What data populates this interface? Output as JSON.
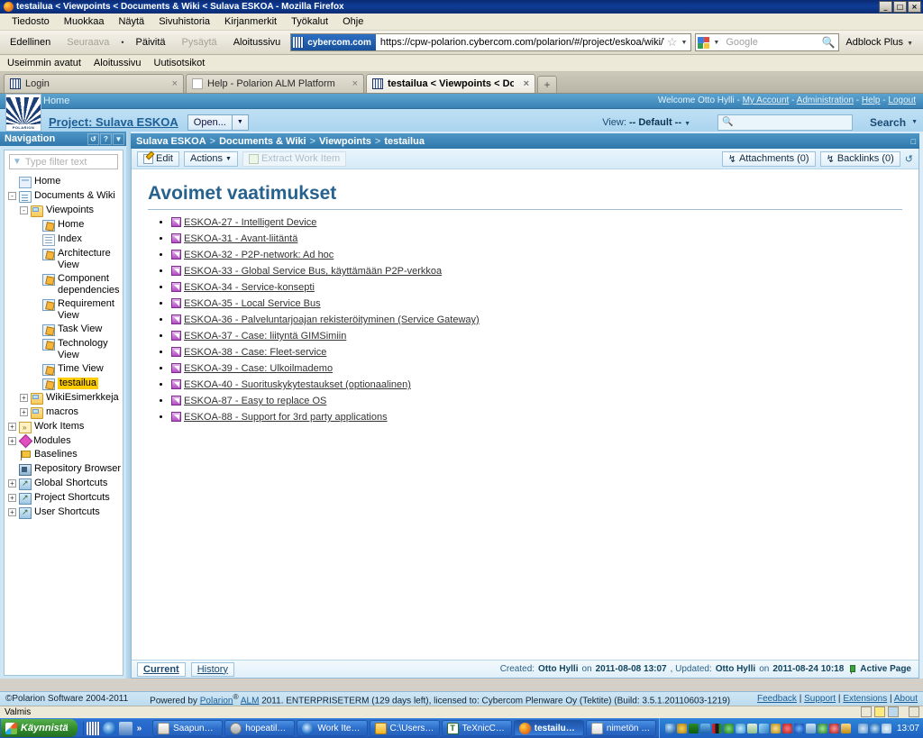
{
  "window": {
    "title": "testailua < Viewpoints < Documents & Wiki < Sulava ESKOA - Mozilla Firefox",
    "minimize": "_",
    "maximize": "□",
    "close": "×"
  },
  "menubar": [
    {
      "label": "Tiedosto"
    },
    {
      "label": "Muokkaa"
    },
    {
      "label": "Näytä"
    },
    {
      "label": "Sivuhistoria"
    },
    {
      "label": "Kirjanmerkit"
    },
    {
      "label": "Työkalut"
    },
    {
      "label": "Ohje"
    }
  ],
  "navbar": {
    "back": "Edellinen",
    "forward": "Seuraava",
    "dot": "•",
    "reload": "Päivitä",
    "stop": "Pysäytä",
    "home": "Aloitussivu",
    "site_identity": "cybercom.com",
    "url": "https://cpw-polarion.cybercom.com/polarion/#/project/eskoa/wiki/Viewpoints/testailua",
    "bookmark_star": "☆",
    "dropdown_caret": "▼",
    "search_engine": "google-icon",
    "search_placeholder": "Google",
    "search_magnifier": "🔍",
    "adblock": "Adblock Plus"
  },
  "bookmarks_bar": [
    {
      "label": "Useimmin avatut"
    },
    {
      "label": "Aloitussivu"
    },
    {
      "label": "Uutisotsikot"
    }
  ],
  "tabs": [
    {
      "label": "Login",
      "close": "×",
      "active": false,
      "favicon": "polarion-favicon"
    },
    {
      "label": "Help - Polarion ALM Platform",
      "close": "×",
      "active": false,
      "favicon": "doc-favicon"
    },
    {
      "label": "testailua < Viewpoints < Docume...",
      "close": "×",
      "active": true,
      "favicon": "polarion-favicon"
    }
  ],
  "new_tab": "+",
  "polarion": {
    "home_crumb": "Home",
    "account": {
      "welcome": "Welcome Otto Hylli",
      "sep": "-",
      "my_account": "My Account",
      "administration": "Administration",
      "help": "Help",
      "logout": "Logout"
    },
    "logo_wordmark": "POLARION",
    "project_label": "Project: Sulava ESKOA",
    "open_button": "Open...",
    "open_caret": "▼",
    "view_label": "View:",
    "view_value": "-- Default --",
    "view_caret": "▼",
    "header_search_placeholder": "",
    "search_button": "Search",
    "search_caret": "▼"
  },
  "navigation": {
    "caption": "Navigation",
    "tool_refresh": "↺",
    "tool_help": "?",
    "tool_menu": "▼",
    "filter_placeholder": "Type filter text",
    "tree": [
      {
        "label": "Home",
        "depth": 0,
        "icon": "page-icon",
        "expander": "none"
      },
      {
        "label": "Documents & Wiki",
        "depth": 0,
        "icon": "doc-icon",
        "expander": "-"
      },
      {
        "label": "Viewpoints",
        "depth": 1,
        "icon": "wiki-folder-icon",
        "expander": "-"
      },
      {
        "label": "Home",
        "depth": 2,
        "icon": "wiki-page-icon",
        "expander": "none"
      },
      {
        "label": "Index",
        "depth": 2,
        "icon": "index-icon",
        "expander": "none"
      },
      {
        "label": "Architecture View",
        "depth": 2,
        "icon": "wiki-page-icon",
        "expander": "none"
      },
      {
        "label": "Component dependencies",
        "depth": 2,
        "icon": "wiki-page-icon",
        "expander": "none"
      },
      {
        "label": "Requirement View",
        "depth": 2,
        "icon": "wiki-page-icon",
        "expander": "none"
      },
      {
        "label": "Task View",
        "depth": 2,
        "icon": "wiki-page-icon",
        "expander": "none"
      },
      {
        "label": "Technology View",
        "depth": 2,
        "icon": "wiki-page-icon",
        "expander": "none"
      },
      {
        "label": "Time View",
        "depth": 2,
        "icon": "wiki-page-icon",
        "expander": "none"
      },
      {
        "label": "testailua",
        "depth": 2,
        "icon": "wiki-page-icon",
        "expander": "none",
        "selected": true
      },
      {
        "label": "WikiEsimerkkeja",
        "depth": 1,
        "icon": "wiki-folder-icon",
        "expander": "+"
      },
      {
        "label": "macros",
        "depth": 1,
        "icon": "wiki-folder-icon",
        "expander": "+"
      },
      {
        "label": "Work Items",
        "depth": 0,
        "icon": "work-item-icon",
        "expander": "+"
      },
      {
        "label": "Modules",
        "depth": 0,
        "icon": "module-icon",
        "expander": "+"
      },
      {
        "label": "Baselines",
        "depth": 0,
        "icon": "flag-icon",
        "expander": "none"
      },
      {
        "label": "Repository Browser",
        "depth": 0,
        "icon": "repository-icon",
        "expander": "none"
      },
      {
        "label": "Global Shortcuts",
        "depth": 0,
        "icon": "shortcut-icon",
        "expander": "+"
      },
      {
        "label": "Project Shortcuts",
        "depth": 0,
        "icon": "shortcut-icon",
        "expander": "+"
      },
      {
        "label": "User Shortcuts",
        "depth": 0,
        "icon": "shortcut-icon",
        "expander": "+"
      }
    ]
  },
  "breadcrumb": {
    "parts": [
      "Sulava ESKOA",
      "Documents & Wiki",
      "Viewpoints",
      "testailua"
    ],
    "separator": ">",
    "corner": "□"
  },
  "doc_toolbar": {
    "edit": "Edit",
    "actions": "Actions",
    "actions_caret": "▼",
    "extract": "Extract Work Item",
    "attachments": "Attachments (0)",
    "backlinks": "Backlinks (0)",
    "pin_glyph": "↯",
    "refresh": "↺"
  },
  "document": {
    "title": "Avoimet vaatimukset",
    "items": [
      {
        "label": "ESKOA-27 - Intelligent Device"
      },
      {
        "label": "ESKOA-31 - Avant-liitäntä"
      },
      {
        "label": "ESKOA-32 - P2P-network: Ad hoc"
      },
      {
        "label": "ESKOA-33 - Global Service Bus, käyttämään P2P-verkkoa"
      },
      {
        "label": "ESKOA-34 - Service-konsepti"
      },
      {
        "label": "ESKOA-35 - Local Service Bus"
      },
      {
        "label": "ESKOA-36 - Palveluntarjoajan rekisteröityminen (Service Gateway)"
      },
      {
        "label": "ESKOA-37 - Case: liityntä GIMSimiin"
      },
      {
        "label": "ESKOA-38 - Case: Fleet-service"
      },
      {
        "label": "ESKOA-39 - Case: Ulkoilmademo"
      },
      {
        "label": "ESKOA-40 - Suorituskykytestaukset (optionaalinen)"
      },
      {
        "label": "ESKOA-87 - Easy to replace OS"
      },
      {
        "label": "ESKOA-88 - Support for 3rd party applications"
      }
    ]
  },
  "doc_footer": {
    "tab_current": "Current",
    "tab_history": "History",
    "created_label": "Created:",
    "created_user": "Otto Hylli",
    "created_on": "on",
    "created_date": "2011-08-08 13:07",
    "updated_label": ", Updated:",
    "updated_user": "Otto Hylli",
    "updated_on": "on",
    "updated_date": "2011-08-24 10:18",
    "active_page": "Active Page"
  },
  "polarion_footer": {
    "copyright": "©Polarion Software 2004-2011",
    "powered_prefix": "Powered by",
    "powered_link": "Polarion",
    "powered_reg": "®",
    "powered_alm": "ALM",
    "powered_rest": "2011. ENTERPRISETERM (129 days left), licensed to: Cybercom Plenware Oy (Tektite) (Build: 3.5.1.20110603-1219)",
    "links": [
      "Feedback",
      "Support",
      "Extensions",
      "About"
    ],
    "link_sep": "|"
  },
  "ff_status": "Valmis",
  "taskbar": {
    "start": "Käynnistä",
    "quick_launch": [
      "polarion-quick-icon",
      "internet-explorer-icon",
      "show-desktop-icon"
    ],
    "chevron": "»",
    "tasks": [
      {
        "label": "Saapuneet ...",
        "icon": "mail-icon",
        "active": false
      },
      {
        "label": "hopeatilhi.c...",
        "icon": "gear-icon",
        "active": false
      },
      {
        "label": "Work Items...",
        "icon": "internet-explorer-icon",
        "active": false
      },
      {
        "label": "C:\\Users\\O...",
        "icon": "folder-icon",
        "active": false
      },
      {
        "label": "TeXnicCent...",
        "icon": "texnic-icon",
        "active": false
      },
      {
        "label": "testailua ...",
        "icon": "firefox-icon",
        "active": true
      },
      {
        "label": "nimetön - P...",
        "icon": "paint-icon",
        "active": false
      }
    ],
    "clock": "13:07"
  }
}
